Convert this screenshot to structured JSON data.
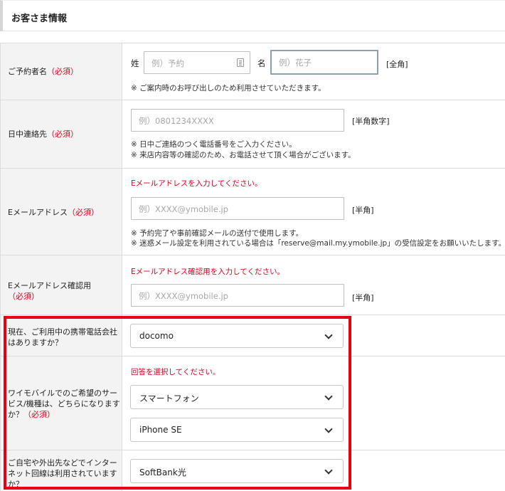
{
  "section": {
    "title": "お客さま情報"
  },
  "name_row": {
    "label": "ご予約者名",
    "required": "（必須）",
    "surname_label": "姓",
    "surname_placeholder": "例）予約",
    "given_label": "名",
    "given_placeholder": "例）花子",
    "suffix": "[全角]",
    "note": "※ ご案内時のお呼び出しのため利用させていただきます。"
  },
  "phone_row": {
    "label": "日中連絡先",
    "required": "（必須）",
    "placeholder": "例）0801234XXXX",
    "suffix": "[半角数字]",
    "note1": "※ 日中ご連絡のつく電話番号をご入力ください。",
    "note2": "※ 来店内容等の確認のため、お電話させて頂く場合がございます。"
  },
  "email_row": {
    "label": "Eメールアドレス",
    "required": "（必須）",
    "error": "Eメールアドレスを入力してください。",
    "placeholder": "例）XXXX@ymobile.jp",
    "suffix": "[半角]",
    "note1": "※ 予約完了や事前確認メールの送付で使用します。",
    "note2": "※ 迷惑メール設定を利用されている場合は「reserve@mail.my.ymobile.jp」の受信設定をお願いいたします。"
  },
  "email_confirm_row": {
    "label": "Eメールアドレス確認用",
    "required": "（必須）",
    "error": "Eメールアドレス確認用を入力してください。",
    "placeholder": "例）XXXX@ymobile.jp",
    "suffix": "[半角]"
  },
  "carrier_row": {
    "label_line1": "現在、ご利用中の携帯電話会社",
    "label_line2": "はありますか？",
    "selected": "docomo"
  },
  "service_row": {
    "label_line1": "ワイモバイルでのご希望のサー",
    "label_line2": "ビス/機種は、どちらになります",
    "label_line3": "か？",
    "required": "（必須）",
    "error": "回答を選択してください。",
    "service_selected": "スマートフォン",
    "device_selected": "iPhone SE"
  },
  "line_row": {
    "label_line1": "ご自宅や外出先などでインター",
    "label_line2": "ネット回線は利用されています",
    "label_line3": "か？",
    "selected": "SoftBank光"
  }
}
